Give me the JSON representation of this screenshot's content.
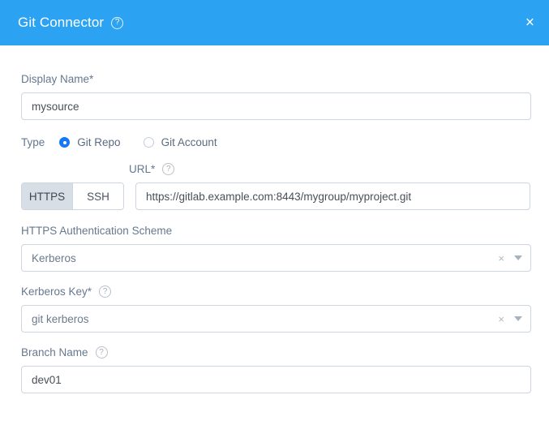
{
  "header": {
    "title": "Git Connector",
    "help_icon": "question-circle-icon",
    "close_icon": "×",
    "background_color": "#2ba3f2"
  },
  "form": {
    "display_name": {
      "label": "Display Name*",
      "value": "mysource",
      "placeholder": ""
    },
    "type": {
      "label": "Type",
      "options": [
        {
          "label": "Git Repo",
          "selected": true
        },
        {
          "label": "Git Account",
          "selected": false
        }
      ]
    },
    "url": {
      "label": "URL*",
      "help_icon": "question-circle-icon",
      "protocols": [
        {
          "label": "HTTPS",
          "active": true
        },
        {
          "label": "SSH",
          "active": false
        }
      ],
      "value": "https://gitlab.example.com:8443/mygroup/myproject.git",
      "placeholder": ""
    },
    "auth_scheme": {
      "label": "HTTPS Authentication Scheme",
      "value": "Kerberos",
      "clear_icon": "×",
      "caret_icon": "chevron-down-icon"
    },
    "kerberos_key": {
      "label": "Kerberos Key*",
      "help_icon": "question-circle-icon",
      "value": "git kerberos",
      "clear_icon": "×",
      "caret_icon": "chevron-down-icon"
    },
    "branch_name": {
      "label": "Branch Name",
      "help_icon": "question-circle-icon",
      "value": "dev01",
      "placeholder": ""
    }
  }
}
